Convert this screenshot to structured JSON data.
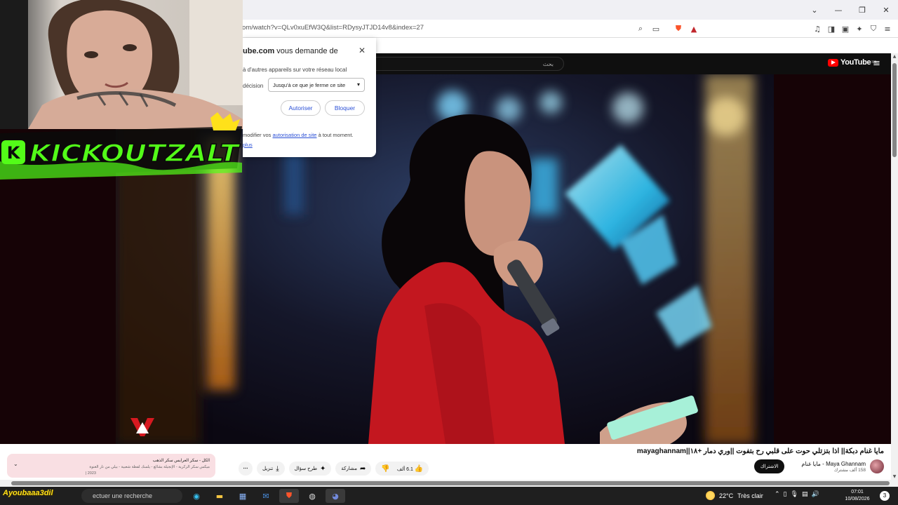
{
  "browser": {
    "url": "om/watch?v=QLv0xuEfW3Q&list=RDysyJTJD14v8&index=27",
    "window_controls": [
      "⌄",
      "—",
      "❐",
      "✕"
    ]
  },
  "permission_popup": {
    "title_domain": "ube.com",
    "title_rest": " vous demande de",
    "description": "à d'autres appareils sur votre réseau local",
    "decision_label": "décision",
    "select_value": "Jusqu'à ce que je ferme ce site",
    "allow_label": "Autoriser",
    "block_label": "Bloquer",
    "footer_prefix": "modifier vos ",
    "footer_link": "autorisation de site",
    "footer_suffix": " à tout moment.",
    "more_link": "plus"
  },
  "overlay": {
    "kick_text": "KICKOUTZALT",
    "kick_badge": "K",
    "handle": "Ayoubaaa3dil"
  },
  "youtube": {
    "search_placeholder": "بحث",
    "logo_text": "YouTube",
    "logo_region": "MA",
    "video_title": "مايا غنام دبكة|| اذا بتزتلي حوت على قلبي رح بتفوت ||وري دمار +١٨||mayaghannam",
    "channel_name": "Maya Ghannam - مايا غنام",
    "channel_subs": "158 ألف مشترك",
    "subscribe_label": "الاشتراك",
    "like_count": "6.1 ألف",
    "share_label": "مشاركة",
    "remix_label": "طرح سؤال",
    "download_label": "تنزيل",
    "playlist": {
      "title": "الكل - سكر العرايس سكر الذهب",
      "subtitle": "ميكس سكر الزكرية - الإنجيلة بشالغ - يلسك لفظة شعبية - بيلي من نار الغنوة",
      "year": "2023 |"
    }
  },
  "taskbar": {
    "search_placeholder": "ectuer une recherche",
    "weather_temp": "22°C",
    "weather_desc": "Très clair",
    "time": "07:01",
    "date": "10/08/2026",
    "notifications": "3"
  },
  "colors": {
    "youtube_red": "#ff0000",
    "link_blue": "#2b50d6",
    "kick_green": "#53fc18"
  }
}
